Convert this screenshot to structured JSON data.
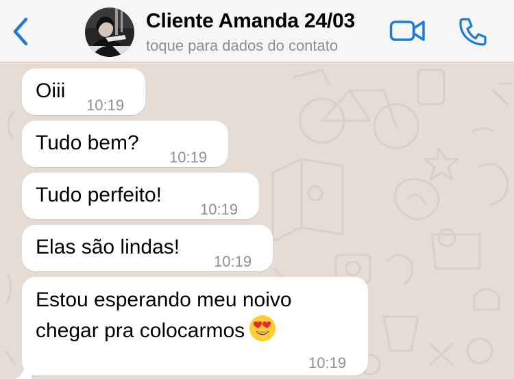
{
  "header": {
    "contact_name": "Cliente Amanda 24/03",
    "subtitle": "toque para dados do contato",
    "accent_color": "#1d7bd3",
    "icons": [
      "chevron-left-icon",
      "video-camera-icon",
      "phone-icon"
    ]
  },
  "messages": [
    {
      "text": "Oiii",
      "time": "10:19"
    },
    {
      "text": "Tudo bem?",
      "time": "10:19"
    },
    {
      "text": "Tudo perfeito!",
      "time": "10:19"
    },
    {
      "text": "Elas são lindas!",
      "time": "10:19"
    },
    {
      "lines": [
        "Estou esperando meu noivo",
        "chegar pra colocarmos"
      ],
      "emoji": "heart-eyes-emoji",
      "time": "10:19"
    }
  ]
}
